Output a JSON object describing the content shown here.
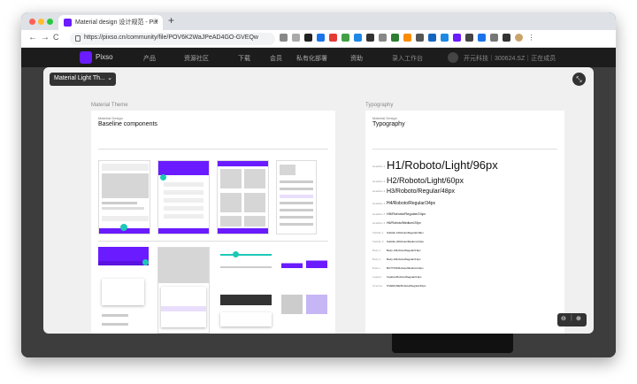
{
  "browser": {
    "tab_title": "Material design 设计规范 - Pix",
    "url": "https://pixso.cn/community/file/POV6K2WaJPeAD4GO-GVEQw",
    "nav": {
      "back": "←",
      "forward": "→",
      "reload": "C"
    }
  },
  "app": {
    "logo": "Pixso",
    "nav": [
      "产品",
      "资源社区",
      "下载",
      "会员",
      "私有化部署",
      "资助"
    ],
    "cta": "录入工作台",
    "notice": "开元科技｜300624.SZ｜正在成员"
  },
  "modal": {
    "theme_select": "Material Light Th...",
    "frames": [
      {
        "label": "Material Theme",
        "small": "Material Design",
        "title": "Baseline components"
      },
      {
        "label": "Typography",
        "small": "Material Design",
        "title": "Typography",
        "rows": [
          {
            "tag": "Headline 1",
            "text": "H1/Roboto/Light/96px"
          },
          {
            "tag": "Headline 2",
            "text": "H2/Roboto/Light/60px"
          },
          {
            "tag": "Headline 3",
            "text": "H3/Roboto/Regular/48px"
          },
          {
            "tag": "Headline 4",
            "text": "H4/Roboto/Regular/34px"
          },
          {
            "tag": "Headline 5",
            "text": "H5/Roboto/Regular/24px"
          },
          {
            "tag": "Headline 6",
            "text": "H6/Roboto/Medium/20px"
          },
          {
            "tag": "Subtitle 1",
            "text": "Subtitle 1/Roboto/Regular/16px"
          },
          {
            "tag": "Subtitle 2",
            "text": "Subtitle 2/Roboto/Medium/14px"
          },
          {
            "tag": "Body 1",
            "text": "Body 1/Roboto/Regular/16px"
          },
          {
            "tag": "Body 2",
            "text": "Body 2/Roboto/Regular/14px"
          },
          {
            "tag": "Button",
            "text": "BUTTON/Roboto/Medium/14px"
          },
          {
            "tag": "Caption",
            "text": "Caption/Roboto/Regular/12px"
          },
          {
            "tag": "Overline",
            "text": "OVERLINE/Roboto/Regular/10px"
          }
        ]
      }
    ],
    "zoom": {
      "out": "⊖",
      "sep": "|",
      "in": "⊕"
    }
  },
  "colors": {
    "accent": "#6a1bff",
    "teal": "#1ec8b7",
    "dark": "#1c1c1c"
  },
  "icons": [
    "lock-icon",
    "collapse-icon",
    "chevron-down-icon",
    "zoom-out-icon",
    "zoom-in-icon"
  ]
}
